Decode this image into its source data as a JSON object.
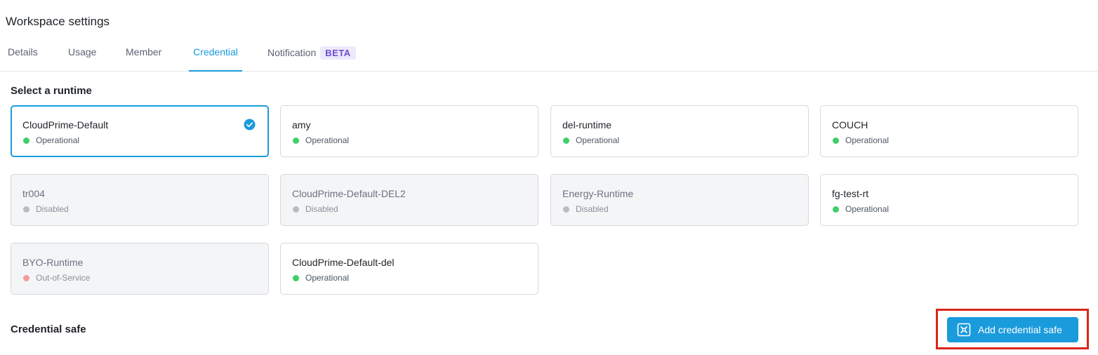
{
  "page": {
    "title": "Workspace settings"
  },
  "tabs": [
    {
      "label": "Details",
      "active": false
    },
    {
      "label": "Usage",
      "active": false
    },
    {
      "label": "Member",
      "active": false
    },
    {
      "label": "Credential",
      "active": true
    },
    {
      "label": "Notification",
      "active": false,
      "badge": "BETA"
    }
  ],
  "runtime_section": {
    "title": "Select a runtime",
    "cards": [
      {
        "name": "CloudPrime-Default",
        "status": "Operational",
        "selected": true
      },
      {
        "name": "amy",
        "status": "Operational"
      },
      {
        "name": "del-runtime",
        "status": "Operational"
      },
      {
        "name": "COUCH",
        "status": "Operational"
      },
      {
        "name": "tr004",
        "status": "Disabled"
      },
      {
        "name": "CloudPrime-Default-DEL2",
        "status": "Disabled"
      },
      {
        "name": "Energy-Runtime",
        "status": "Disabled"
      },
      {
        "name": "fg-test-rt",
        "status": "Operational"
      },
      {
        "name": "BYO-Runtime",
        "status": "Out-of-Service"
      },
      {
        "name": "CloudPrime-Default-del",
        "status": "Operational"
      }
    ]
  },
  "credential_section": {
    "title": "Credential safe",
    "add_button_label": "Add credential safe"
  },
  "colors": {
    "accent": "#1a9bdc",
    "operational": "#3fcf6a",
    "disabled": "#b8bcc2",
    "out_of_service": "#f29b9b",
    "highlight": "#d9261c"
  },
  "icons": {
    "selected": "check-circle-icon",
    "add_button": "credential-safe-icon"
  }
}
